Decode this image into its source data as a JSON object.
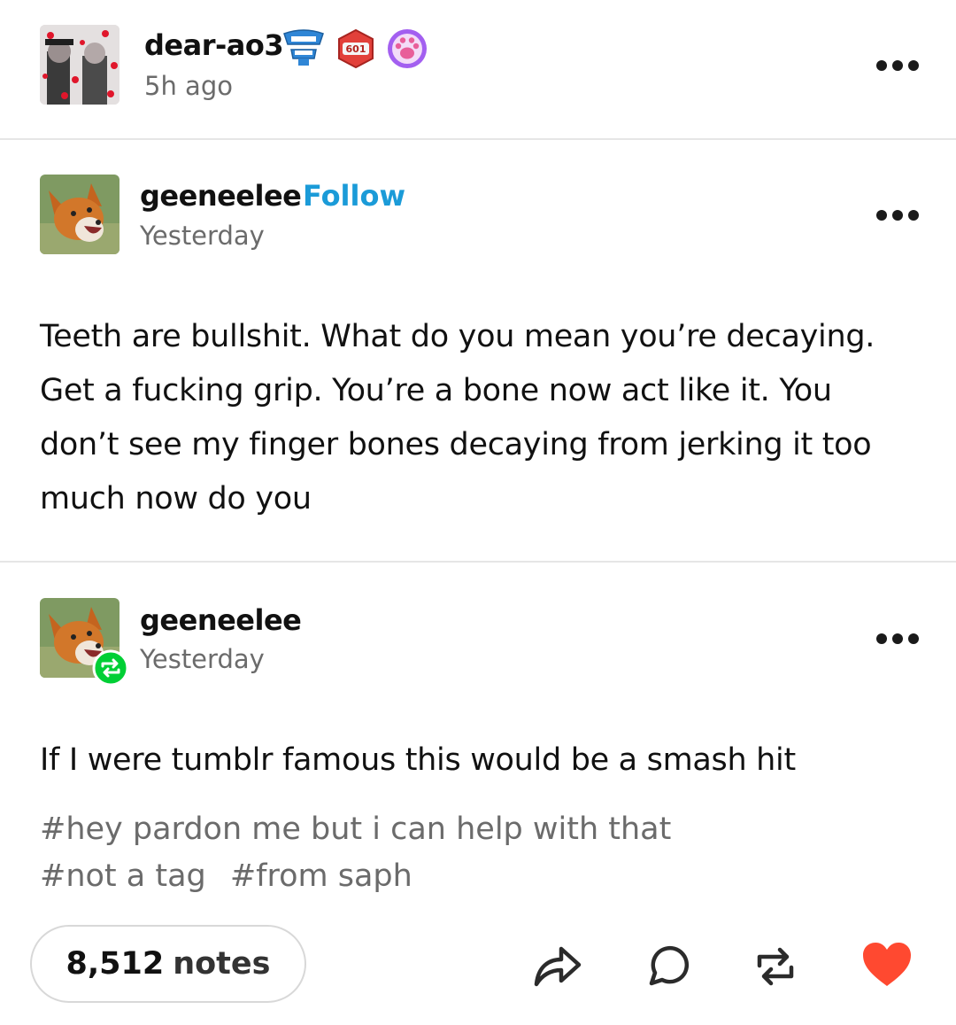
{
  "reblogger": {
    "username": "dear-ao3",
    "time": "5h ago",
    "badge_count": "601"
  },
  "original_post": {
    "username": "geeneelee",
    "follow_label": "Follow",
    "time": "Yesterday",
    "lines": [
      "Teeth are bullshit. What do you mean you’re decaying.",
      "Get a fucking grip. You’re a bone now act like it. You",
      "don’t see my finger bones decaying from jerking it too",
      "much now do you"
    ]
  },
  "reply_post": {
    "username": "geeneelee",
    "time": "Yesterday",
    "text": "If I were tumblr famous this would be a smash hit",
    "tags": [
      "#hey pardon me but i can help with that",
      "#not a tag",
      "#from saph"
    ]
  },
  "footer": {
    "notes_count": "8,512",
    "notes_label": "notes"
  },
  "colors": {
    "follow": "#1b9bd8",
    "reblog_badge": "#00cf35",
    "heart": "#ff4930",
    "badge_red": "#e2403a",
    "badge_purple": "#a35ff0"
  },
  "icons": [
    "share-icon",
    "reply-icon",
    "reblog-icon",
    "heart-icon"
  ]
}
